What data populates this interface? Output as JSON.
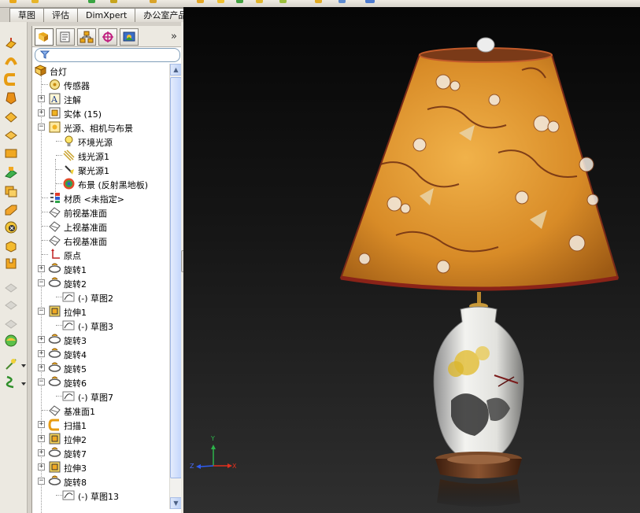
{
  "command_tabs": [
    "草图",
    "评估",
    "DimXpert",
    "办公室产品"
  ],
  "feature_tree": {
    "root": "台灯",
    "items": [
      {
        "label": "传感器",
        "icon": "sensor-icon"
      },
      {
        "label": "注解",
        "icon": "annotation-icon"
      },
      {
        "label": "实体 (15)",
        "icon": "solid-bodies-icon"
      },
      {
        "label": "光源、相机与布景",
        "icon": "lights-cameras-scene-icon"
      },
      {
        "label": "环境光源",
        "icon": "ambient-light-icon"
      },
      {
        "label": "线光源1",
        "icon": "directional-light-icon"
      },
      {
        "label": "聚光源1",
        "icon": "spot-light-icon"
      },
      {
        "label": "布景 (反射黑地板)",
        "icon": "scene-icon"
      },
      {
        "label": "材质 <未指定>",
        "icon": "material-icon"
      },
      {
        "label": "前视基准面",
        "icon": "plane-icon"
      },
      {
        "label": "上视基准面",
        "icon": "plane-icon"
      },
      {
        "label": "右视基准面",
        "icon": "plane-icon"
      },
      {
        "label": "原点",
        "icon": "origin-icon"
      },
      {
        "label": "旋转1",
        "icon": "revolve-icon"
      },
      {
        "label": "旋转2",
        "icon": "revolve-icon"
      },
      {
        "label": "(-) 草图2",
        "icon": "sketch-icon"
      },
      {
        "label": "拉伸1",
        "icon": "extrude-icon"
      },
      {
        "label": "(-) 草图3",
        "icon": "sketch-icon"
      },
      {
        "label": "旋转3",
        "icon": "revolve-icon"
      },
      {
        "label": "旋转4",
        "icon": "revolve-icon"
      },
      {
        "label": "旋转5",
        "icon": "revolve-icon"
      },
      {
        "label": "旋转6",
        "icon": "revolve-icon"
      },
      {
        "label": "(-) 草图7",
        "icon": "sketch-icon"
      },
      {
        "label": "基准面1",
        "icon": "plane-icon"
      },
      {
        "label": "扫描1",
        "icon": "sweep-icon"
      },
      {
        "label": "拉伸2",
        "icon": "extrude-icon"
      },
      {
        "label": "旋转7",
        "icon": "revolve-icon"
      },
      {
        "label": "拉伸3",
        "icon": "extrude-icon"
      },
      {
        "label": "旋转8",
        "icon": "revolve-icon"
      },
      {
        "label": "(-) 草图13",
        "icon": "sketch-icon"
      }
    ]
  },
  "triad": {
    "x": "X",
    "y": "Y",
    "z": "Z"
  },
  "colors": {
    "shade": "#d98e2c",
    "shade_trim": "#8a2318",
    "vase_flower": "#e3bf3d",
    "vase_leaf": "#2f2f2f",
    "base_wood": "#6b3b22",
    "tree_selection_blue": "#316ac5"
  }
}
